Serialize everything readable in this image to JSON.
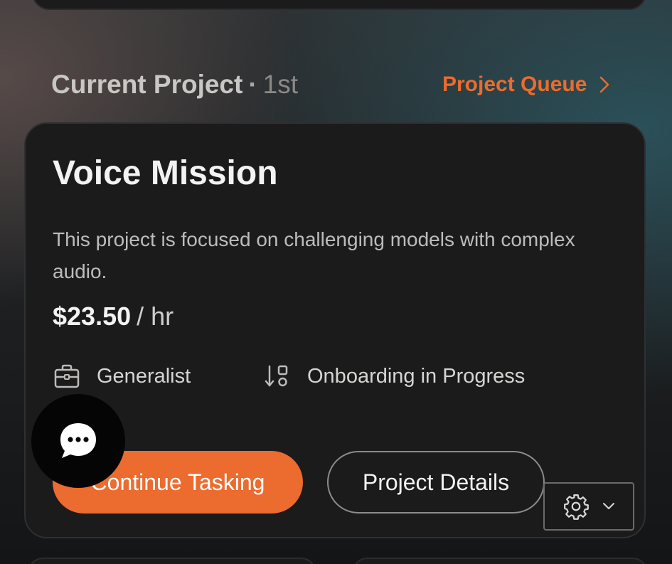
{
  "header": {
    "section_title": "Current Project",
    "separator": "·",
    "rank": "1st",
    "queue_link_label": "Project Queue",
    "queue_link_icon": "chevron-right-icon"
  },
  "project": {
    "title": "Voice Mission",
    "description": "This project is focused on challenging models with complex audio.",
    "rate_amount": "$23.50",
    "rate_unit": "/ hr",
    "role_icon": "briefcase-icon",
    "role": "Generalist",
    "status_icon": "sort-status-icon",
    "status": "Onboarding in Progress"
  },
  "actions": {
    "continue_label": "Continue Tasking",
    "details_label": "Project Details",
    "settings_icon": "gear-icon",
    "settings_chevron_icon": "chevron-down-icon"
  },
  "chat": {
    "icon": "chat-bubble-icon"
  },
  "colors": {
    "accent": "#ec6b2f",
    "card_background": "#1b1b1c",
    "title_text": "#f3f3f3"
  }
}
